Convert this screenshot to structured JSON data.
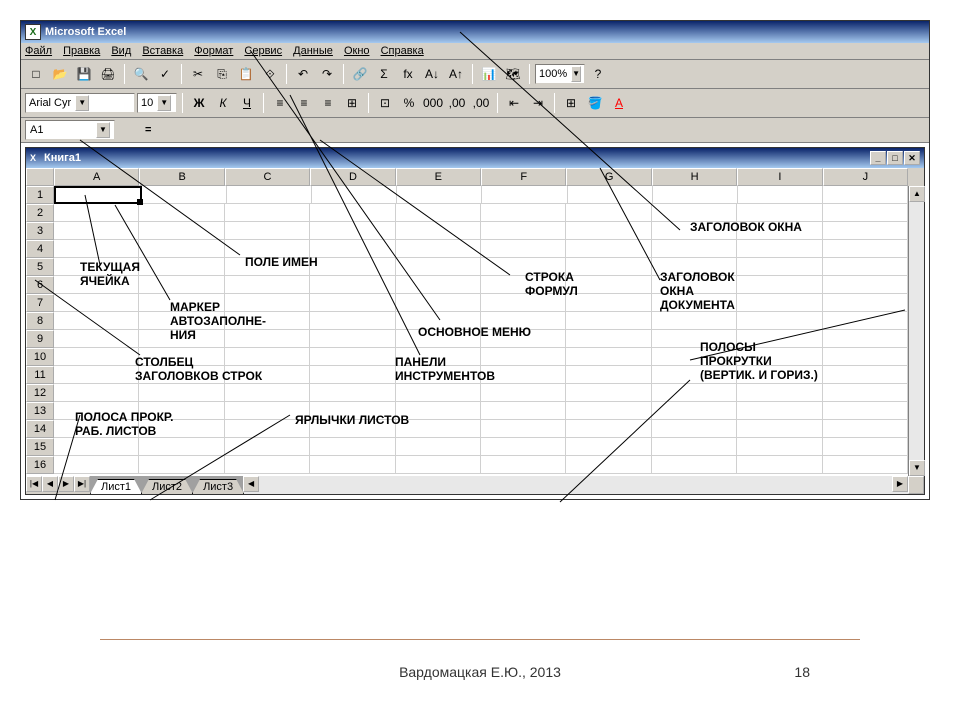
{
  "app_title": "Microsoft Excel",
  "menu": [
    "Файл",
    "Правка",
    "Вид",
    "Вставка",
    "Формат",
    "Сервис",
    "Данные",
    "Окно",
    "Справка"
  ],
  "font_name": "Arial Cyr",
  "font_size": "10",
  "zoom": "100%",
  "name_box": "A1",
  "doc_title": "Книга1",
  "columns": [
    "A",
    "B",
    "C",
    "D",
    "E",
    "F",
    "G",
    "H",
    "I",
    "J"
  ],
  "rows": [
    "1",
    "2",
    "3",
    "4",
    "5",
    "6",
    "7",
    "8",
    "9",
    "10",
    "11",
    "12",
    "13",
    "14",
    "15",
    "16"
  ],
  "sheets": [
    "Лист1",
    "Лист2",
    "Лист3"
  ],
  "active_sheet": 0,
  "toolbar_glyphs": {
    "new": "□",
    "open": "📂",
    "save": "💾",
    "print": "🖨",
    "preview": "🔍",
    "spell": "✓",
    "cut": "✂",
    "copy": "⎘",
    "paste": "📋",
    "format": "⟐",
    "undo": "↶",
    "redo": "↷",
    "link": "🔗",
    "sum": "Σ",
    "fx": "fх",
    "asc": "A↓",
    "desc": "A↑",
    "chart": "📊",
    "map": "🗺",
    "help": "?",
    "bold": "Ж",
    "italic": "К",
    "underline": "Ч",
    "left": "≡",
    "center": "≡",
    "right": "≡",
    "merge": "⊞",
    "currency": "⊡",
    "percent": "%",
    "comma": "000",
    "inc": ",00",
    "dec": ",00",
    "outdent": "⇤",
    "indent": "⇥",
    "border": "⊞",
    "fill": "🪣",
    "font": "A"
  },
  "annotations": {
    "a1": "ЗАГОЛОВОК ОКНА",
    "a2": "ЗАГОЛОВОК\nОКНА\nДОКУМЕНТА",
    "a3": "СТРОКА\nФОРМУЛ",
    "a4": "ОСНОВНОЕ МЕНЮ",
    "a5": "ПАНЕЛИ\nИНСТРУМЕНТОВ",
    "a6": "ПОЛЕ ИМЕН",
    "a7": "ТЕКУЩАЯ\nЯЧЕЙКА",
    "a8": "МАРКЕР\nАВТОЗАПОЛНЕ-\nНИЯ",
    "a9": "СТОЛБЕЦ\nЗАГОЛОВКОВ СТРОК",
    "a10": "ПОЛОСА ПРОКР.\nРАБ. ЛИСТОВ",
    "a11": "ЯРЛЫЧКИ ЛИСТОВ",
    "a12": "ПОЛОСЫ\nПРОКРУТКИ\n(ВЕРТИК. И ГОРИЗ.)"
  },
  "footer_text": "Вардомацкая Е.Ю., 2013",
  "page_num": "18"
}
